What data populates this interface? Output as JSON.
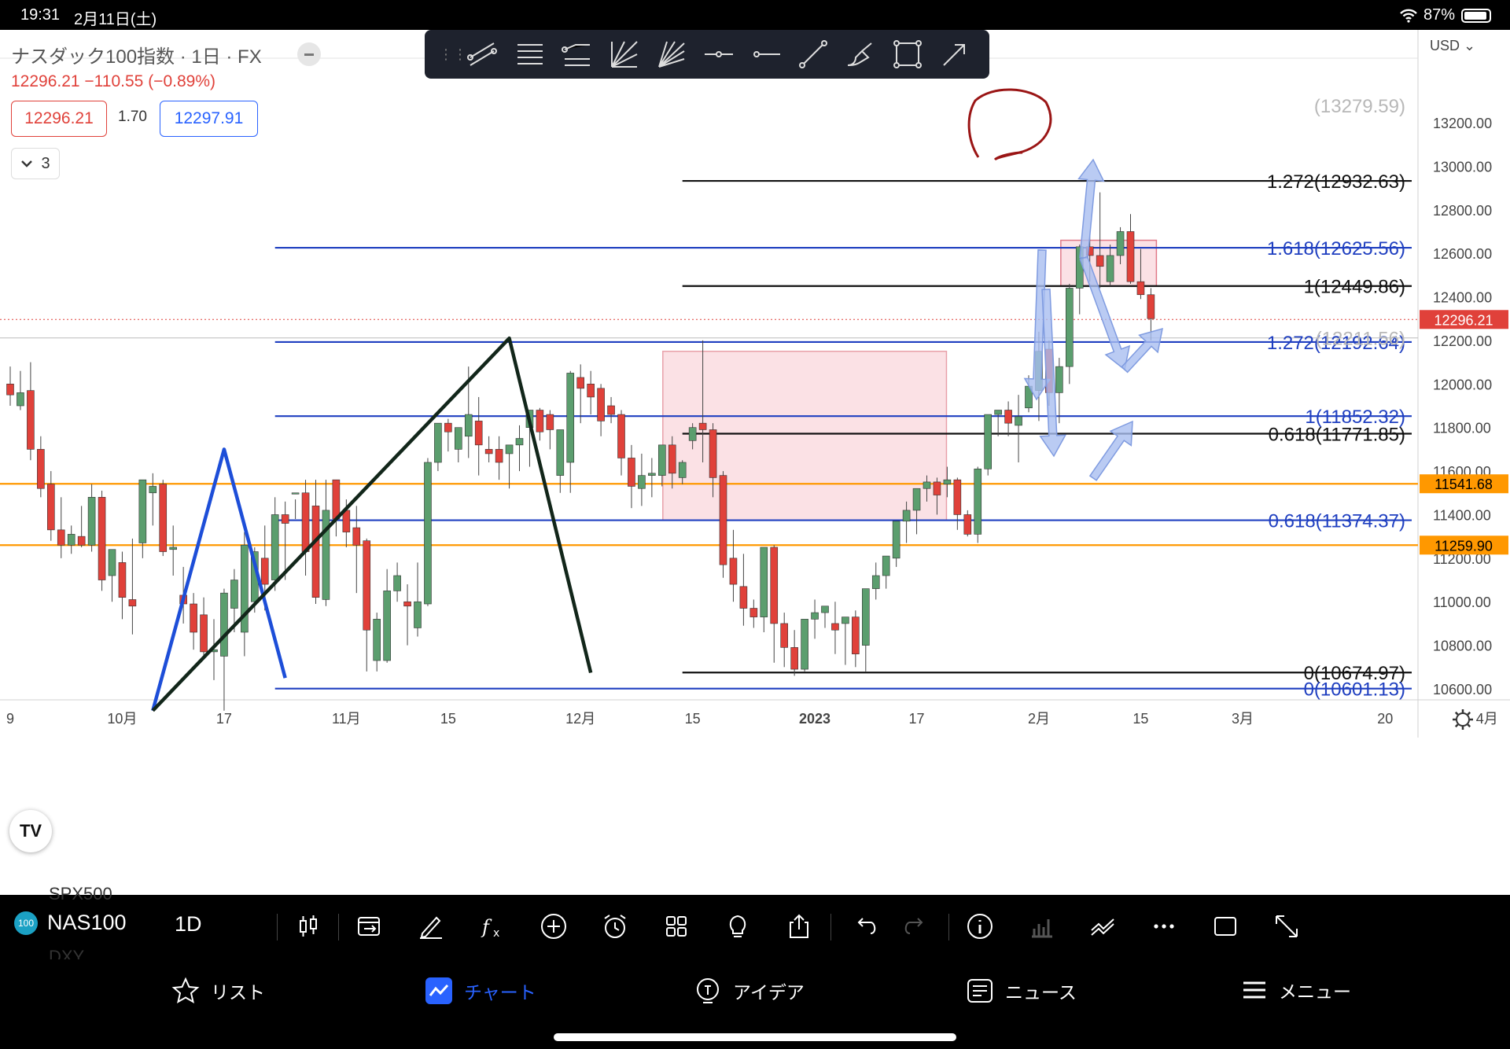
{
  "status_bar": {
    "time": "19:31",
    "date": "2月11日(土)",
    "battery": "87%"
  },
  "chart_header": {
    "title": "ナスダック100指数 · 1日 · FX",
    "price_line": "12296.21  −110.55 (−0.89%)",
    "bid": "12296.21",
    "spread": "1.70",
    "ask": "12297.91",
    "indicators_count": "3",
    "currency": "USD"
  },
  "colors": {
    "up": "#5b9e6e",
    "down": "#e0413a",
    "fib_blue": "#1f3fc0",
    "fib_black": "#111111",
    "orange": "#ff9800",
    "zone": "#f7c9cf",
    "arrow": "#a9bef0"
  },
  "chart_data": {
    "type": "candlestick",
    "y_ticks": [
      "13200.00",
      "13000.00",
      "12800.00",
      "12600.00",
      "12400.00",
      "12200.00",
      "12000.00",
      "11800.00",
      "11600.00",
      "11400.00",
      "11200.00",
      "11000.00",
      "10800.00",
      "10600.00"
    ],
    "ylim": [
      10500,
      13450
    ],
    "x_ticks": [
      {
        "label": "9",
        "i": 0
      },
      {
        "label": "10月",
        "i": 11
      },
      {
        "label": "17",
        "i": 21
      },
      {
        "label": "11月",
        "i": 33
      },
      {
        "label": "15",
        "i": 43
      },
      {
        "label": "12月",
        "i": 56
      },
      {
        "label": "15",
        "i": 67
      },
      {
        "label": "2023",
        "i": 79
      },
      {
        "label": "17",
        "i": 89
      },
      {
        "label": "2月",
        "i": 101
      },
      {
        "label": "15",
        "i": 111
      },
      {
        "label": "3月",
        "i": 121
      },
      {
        "label": "20",
        "i": 135
      },
      {
        "label": "4月",
        "i": 145
      }
    ],
    "candles": [
      [
        0,
        12000,
        12080,
        11950,
        11900
      ],
      [
        1,
        11900,
        12060,
        11960,
        11880
      ],
      [
        2,
        11970,
        12100,
        11700,
        11650
      ],
      [
        3,
        11700,
        11760,
        11520,
        11480
      ],
      [
        4,
        11540,
        11600,
        11330,
        11280
      ],
      [
        5,
        11330,
        11480,
        11260,
        11200
      ],
      [
        6,
        11260,
        11350,
        11310,
        11220
      ],
      [
        7,
        11300,
        11440,
        11260,
        11250
      ],
      [
        8,
        11260,
        11540,
        11480,
        11230
      ],
      [
        9,
        11480,
        11510,
        11100,
        11050
      ],
      [
        10,
        11120,
        11180,
        11240,
        11000
      ],
      [
        11,
        11180,
        11230,
        11020,
        10920
      ],
      [
        12,
        11010,
        11290,
        10980,
        10850
      ],
      [
        13,
        11270,
        11560,
        11560,
        11200
      ],
      [
        14,
        11500,
        11590,
        11530,
        11350
      ],
      [
        15,
        11540,
        11560,
        11230,
        11210
      ],
      [
        16,
        11240,
        11350,
        11250,
        11120
      ],
      [
        17,
        11030,
        11160,
        10990,
        10900
      ],
      [
        18,
        10990,
        11040,
        10860,
        10780
      ],
      [
        19,
        10940,
        11020,
        10770,
        10750
      ],
      [
        20,
        10770,
        10920,
        10780,
        10640
      ],
      [
        21,
        10750,
        11060,
        11040,
        10500
      ],
      [
        22,
        10970,
        11150,
        11100,
        10860
      ],
      [
        23,
        10860,
        11320,
        11260,
        10750
      ],
      [
        24,
        11000,
        11250,
        11230,
        10950
      ],
      [
        25,
        11200,
        11350,
        11080,
        10960
      ],
      [
        26,
        11100,
        11480,
        11400,
        11050
      ],
      [
        27,
        11400,
        11460,
        11360,
        11100
      ],
      [
        28,
        11500,
        11470,
        11500,
        11380
      ],
      [
        29,
        11500,
        11560,
        11230,
        11120
      ],
      [
        30,
        11440,
        11560,
        11020,
        10990
      ],
      [
        31,
        11010,
        11560,
        11420,
        10980
      ],
      [
        32,
        11560,
        11560,
        11380,
        11300
      ],
      [
        33,
        11420,
        11470,
        11320,
        11250
      ],
      [
        34,
        11340,
        11440,
        11260,
        11040
      ],
      [
        35,
        11280,
        11290,
        10870,
        10680
      ],
      [
        36,
        10730,
        10950,
        10920,
        10680
      ],
      [
        37,
        10730,
        11150,
        11050,
        10720
      ],
      [
        38,
        11050,
        11180,
        11120,
        11000
      ],
      [
        39,
        11000,
        11080,
        10980,
        10800
      ],
      [
        40,
        10880,
        11180,
        11000,
        10840
      ],
      [
        41,
        10990,
        11660,
        11640,
        10980
      ],
      [
        42,
        11640,
        11820,
        11820,
        11600
      ],
      [
        43,
        11820,
        11840,
        11780,
        11690
      ],
      [
        44,
        11700,
        11800,
        11800,
        11640
      ],
      [
        45,
        11760,
        12080,
        11860,
        11660
      ],
      [
        46,
        11830,
        11940,
        11720,
        11580
      ],
      [
        47,
        11700,
        11760,
        11680,
        11640
      ],
      [
        48,
        11700,
        11760,
        11640,
        11560
      ],
      [
        49,
        11680,
        11700,
        11720,
        11520
      ],
      [
        50,
        11720,
        11810,
        11750,
        11600
      ],
      [
        51,
        11800,
        11850,
        11880,
        11620
      ],
      [
        52,
        11880,
        11890,
        11780,
        11740
      ],
      [
        53,
        11860,
        11880,
        11790,
        11700
      ],
      [
        54,
        11580,
        11780,
        11790,
        11500
      ],
      [
        55,
        11640,
        12060,
        12050,
        11500
      ],
      [
        56,
        12030,
        12090,
        11980,
        11820
      ],
      [
        57,
        12000,
        12060,
        11940,
        11860
      ],
      [
        58,
        11980,
        12000,
        11830,
        11760
      ],
      [
        59,
        11900,
        11940,
        11860,
        11820
      ],
      [
        60,
        11860,
        11880,
        11660,
        11580
      ],
      [
        61,
        11660,
        11720,
        11530,
        11430
      ],
      [
        62,
        11520,
        11680,
        11580,
        11440
      ],
      [
        63,
        11580,
        11660,
        11590,
        11480
      ],
      [
        64,
        11580,
        11700,
        11720,
        11530
      ],
      [
        65,
        11720,
        11760,
        11590,
        11520
      ],
      [
        66,
        11570,
        11650,
        11640,
        11540
      ],
      [
        67,
        11740,
        11820,
        11800,
        11700
      ],
      [
        68,
        11820,
        12200,
        11790,
        11640
      ],
      [
        69,
        11790,
        11820,
        11570,
        11480
      ],
      [
        70,
        11580,
        11600,
        11170,
        11110
      ],
      [
        71,
        11200,
        11330,
        11080,
        11000
      ],
      [
        72,
        11070,
        11220,
        10970,
        10890
      ],
      [
        73,
        10970,
        11010,
        10930,
        10880
      ],
      [
        74,
        10930,
        11250,
        11250,
        10860
      ],
      [
        75,
        11250,
        11260,
        10900,
        10720
      ],
      [
        76,
        10900,
        10950,
        10790,
        10700
      ],
      [
        77,
        10790,
        10870,
        10690,
        10660
      ],
      [
        78,
        10690,
        10730,
        10920,
        10680
      ],
      [
        79,
        10920,
        11010,
        10950,
        10830
      ],
      [
        80,
        10950,
        10970,
        10980,
        10880
      ],
      [
        81,
        10900,
        11000,
        10870,
        10760
      ],
      [
        82,
        10900,
        10920,
        10930,
        10710
      ],
      [
        83,
        10930,
        10960,
        10760,
        10700
      ],
      [
        84,
        10800,
        11000,
        11060,
        10680
      ],
      [
        85,
        11060,
        11180,
        11120,
        11010
      ],
      [
        86,
        11120,
        11210,
        11210,
        11060
      ],
      [
        87,
        11200,
        11250,
        11370,
        11160
      ],
      [
        88,
        11370,
        11460,
        11420,
        11270
      ],
      [
        89,
        11420,
        11520,
        11520,
        11310
      ],
      [
        90,
        11520,
        11580,
        11550,
        11460
      ],
      [
        91,
        11550,
        11570,
        11490,
        11400
      ],
      [
        92,
        11540,
        11620,
        11560,
        11480
      ],
      [
        93,
        11560,
        11570,
        11400,
        11330
      ],
      [
        94,
        11400,
        11420,
        11310,
        11300
      ],
      [
        95,
        11310,
        11620,
        11610,
        11270
      ],
      [
        96,
        11610,
        11850,
        11860,
        11580
      ],
      [
        97,
        11860,
        11880,
        11880,
        11760
      ],
      [
        98,
        11880,
        11920,
        11820,
        11760
      ],
      [
        99,
        11810,
        11950,
        11850,
        11640
      ],
      [
        100,
        11890,
        12040,
        11990,
        11870
      ],
      [
        101,
        11970,
        12240,
        12150,
        11830
      ],
      [
        102,
        12160,
        12200,
        11960,
        11900
      ],
      [
        103,
        11960,
        12120,
        12080,
        11820
      ],
      [
        104,
        12080,
        12460,
        12440,
        12000
      ],
      [
        105,
        12440,
        12640,
        12630,
        12320
      ],
      [
        106,
        12630,
        12680,
        12590,
        12470
      ],
      [
        107,
        12590,
        12880,
        12540,
        12440
      ],
      [
        108,
        12470,
        12640,
        12590,
        12450
      ],
      [
        109,
        12590,
        12720,
        12700,
        12550
      ],
      [
        110,
        12700,
        12780,
        12470,
        12460
      ],
      [
        111,
        12470,
        12620,
        12410,
        12390
      ],
      [
        112,
        12410,
        12440,
        12300,
        12200
      ]
    ],
    "fib_levels": [
      {
        "label": "1.272(12932.63)",
        "value": 12932.63,
        "color": "black",
        "from_i": 66
      },
      {
        "label": "1.618(12625.56)",
        "value": 12625.56,
        "color": "blue",
        "from_i": 26
      },
      {
        "label": "1(12449.86)",
        "value": 12449.86,
        "color": "black",
        "from_i": 66
      },
      {
        "label": "1.272(12192.64)",
        "value": 12192.64,
        "color": "blue",
        "from_i": 26
      },
      {
        "label": "1(11852.32)",
        "value": 11852.32,
        "color": "blue",
        "from_i": 26
      },
      {
        "label": "0.618(11771.85)",
        "value": 11771.85,
        "color": "black",
        "from_i": 66
      },
      {
        "label": "0.618(11374.37)",
        "value": 11374.37,
        "color": "blue",
        "from_i": 26
      },
      {
        "label": "0(10674.97)",
        "value": 10674.97,
        "color": "black",
        "from_i": 66
      },
      {
        "label": "0(10601.13)",
        "value": 10601.13,
        "color": "blue",
        "from_i": 26
      }
    ],
    "faded_labels": [
      {
        "label": "(13279.59)",
        "value": 13279.59
      },
      {
        "label": "(12211.56)",
        "value": 12211.56
      }
    ],
    "horizontal_lines": [
      {
        "value": 11541.68,
        "label": "11541.68",
        "color": "orange"
      },
      {
        "value": 11259.9,
        "label": "11259.90",
        "color": "orange"
      }
    ],
    "current_price": {
      "value": 12296.21,
      "label": "12296.21"
    }
  },
  "bottom_toolbar": {
    "symbol": "NAS100",
    "symbol_badge": "100",
    "interval": "1D",
    "faint_above": "SPX500",
    "faint_below": "DXY"
  },
  "tabs": [
    {
      "label": "リスト",
      "icon": "star-icon"
    },
    {
      "label": "チャート",
      "icon": "chart-icon"
    },
    {
      "label": "アイデア",
      "icon": "idea-icon"
    },
    {
      "label": "ニュース",
      "icon": "news-icon"
    },
    {
      "label": "メニュー",
      "icon": "menu-icon"
    }
  ]
}
